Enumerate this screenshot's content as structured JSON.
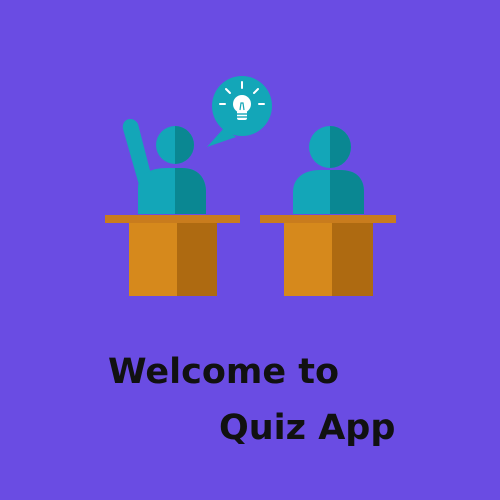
{
  "splash": {
    "title_line_1": "Welcome to",
    "title_line_2": "Quiz App"
  },
  "icons": {
    "illustration": "classroom-students-desks",
    "idea": "lightbulb-idea-icon"
  },
  "colors": {
    "background": "#6a4ce3",
    "figure_light": "#13a6b8",
    "figure_dark": "#0a8792",
    "desk_light": "#d6891c",
    "desk_dark": "#ae6a11",
    "desk_top": "#c97c1d",
    "title_text": "#111111"
  }
}
